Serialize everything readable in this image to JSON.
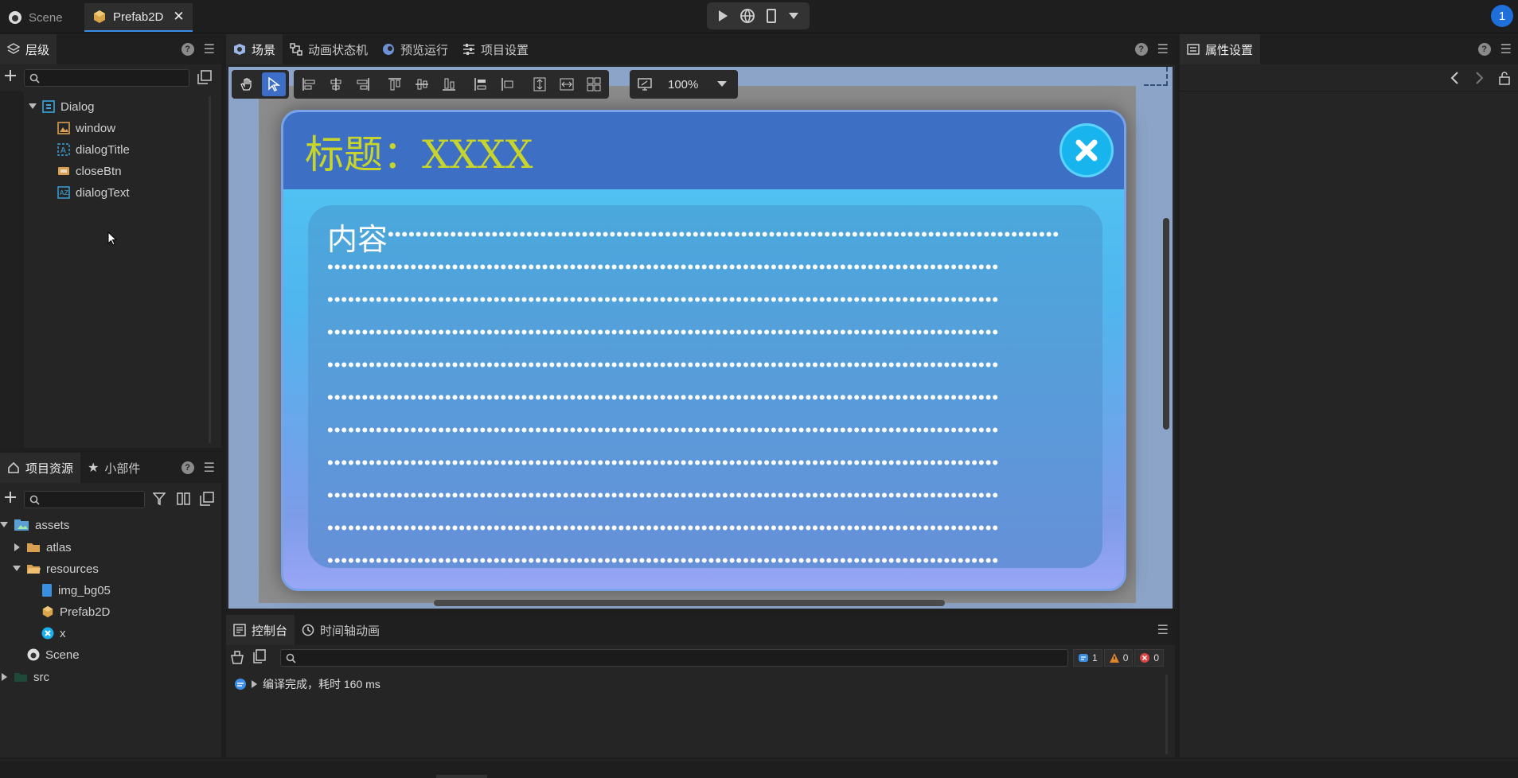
{
  "doc_tabs": [
    {
      "label": "Scene"
    },
    {
      "label": "Prefab2D"
    }
  ],
  "user_badge": "1",
  "hierarchy": {
    "title": "层级",
    "items": [
      "Dialog",
      "window",
      "dialogTitle",
      "closeBtn",
      "dialogText"
    ]
  },
  "assets": {
    "tabs": [
      "项目资源",
      "小部件"
    ],
    "items": [
      "assets",
      "atlas",
      "resources",
      "img_bg05",
      "Prefab2D",
      "x",
      "Scene",
      "src"
    ]
  },
  "scene": {
    "tabs": [
      "场景",
      "动画状态机",
      "预览运行",
      "项目设置"
    ],
    "zoom": "100%",
    "dialog_title": "标题：XXXX",
    "dialog_content": "内容",
    "dots_line": "•••••••••••••••••••••••••••••••••••••••••••••••••••••••••••••••••••••••••••••••••••••••••••••••••"
  },
  "inspector": {
    "title": "属性设置"
  },
  "console": {
    "tabs": [
      "控制台",
      "时间轴动画"
    ],
    "counts": {
      "info": "1",
      "warn": "0",
      "error": "0"
    },
    "message": "编译完成，耗时 160 ms"
  },
  "colors": {
    "accent": "#3a8ee6",
    "title_text": "#c6d42c",
    "close_button": "#18b4ee"
  }
}
